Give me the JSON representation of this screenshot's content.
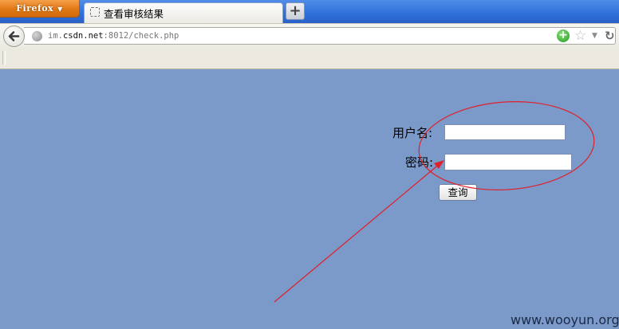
{
  "browser": {
    "menu_button_label": "Firefox",
    "menu_arrow": "▼",
    "tab": {
      "title": "查看审核结果",
      "icon": "blank-page-icon"
    },
    "new_tab_label": "+",
    "url": {
      "prefix": "im.",
      "host": "csdn.net",
      "rest": ":8012/check.php"
    },
    "icons": {
      "back": "back-arrow-icon",
      "site": "globe-icon",
      "go": "go-plus-icon",
      "bookmark": "star-icon",
      "history": "dropdown-icon",
      "reload": "reload-icon"
    }
  },
  "form": {
    "username_label": "用户名:",
    "username_value": "",
    "password_label": "密码:",
    "password_value": "",
    "submit_label": "查询"
  },
  "annotation": {
    "color": "#e0202a"
  },
  "colors": {
    "page_background": "#7b99c9",
    "tab_strip": "#2f6fd8",
    "firefox_button": "#e07815"
  },
  "watermark": "www.wooyun.org"
}
